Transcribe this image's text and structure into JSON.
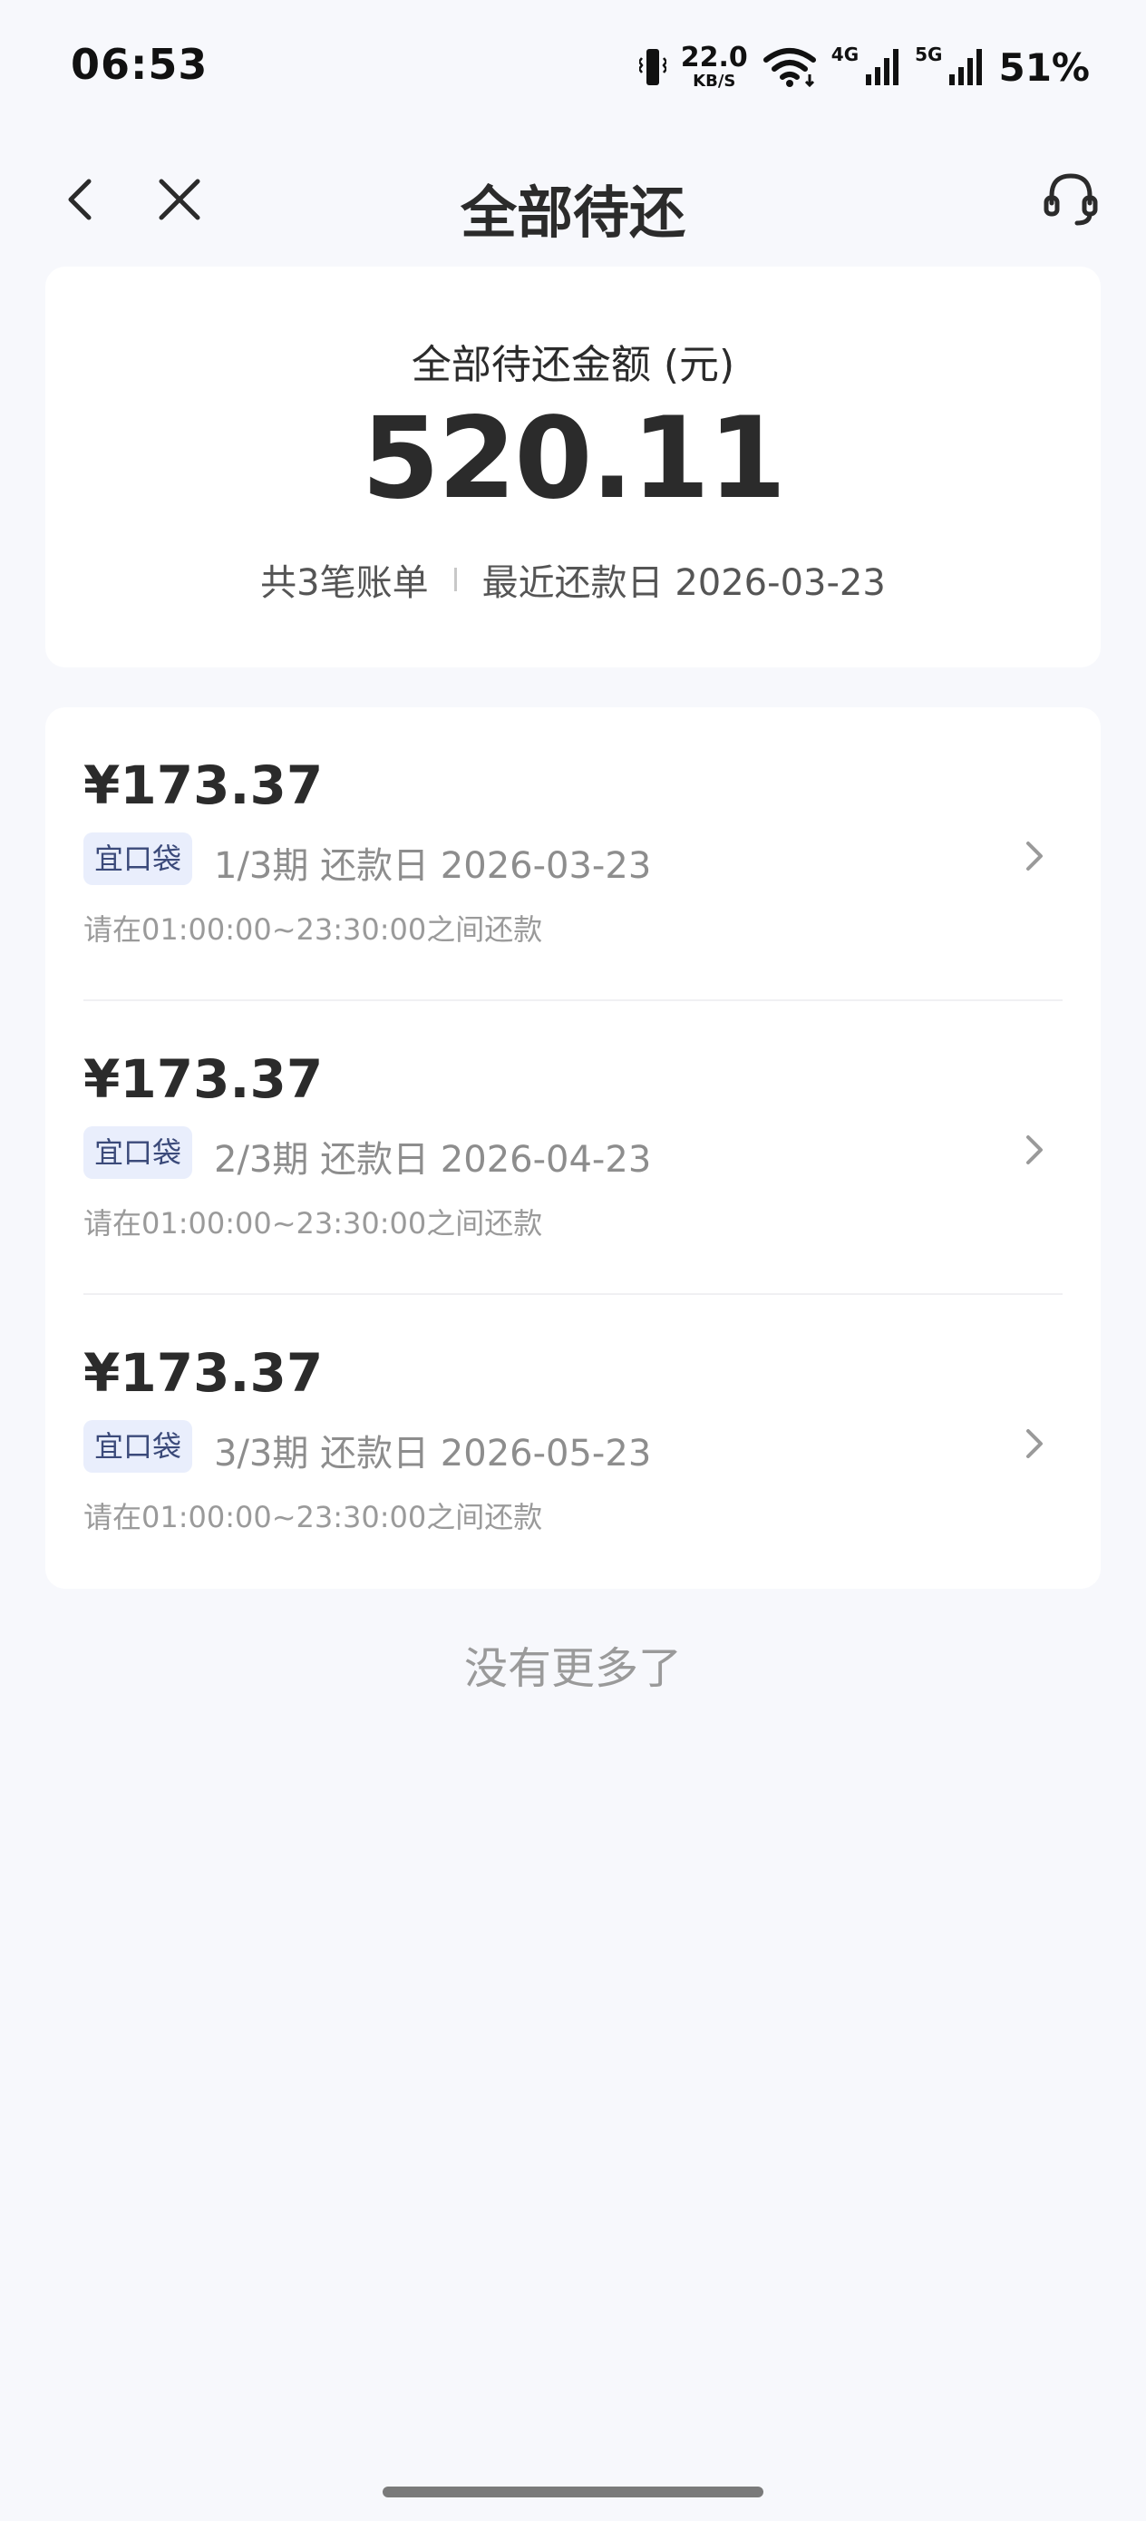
{
  "status_bar": {
    "time": "06:53",
    "net_speed_value": "22.0",
    "net_speed_unit": "KB/S",
    "signal1_label": "4G",
    "signal2_label": "5G",
    "battery": "51%",
    "icons": [
      "vibrate-icon",
      "wifi-icon",
      "signal-icon",
      "signal-icon"
    ]
  },
  "nav": {
    "title": "全部待还",
    "icons": [
      "back-icon",
      "close-icon",
      "customer-service-icon"
    ]
  },
  "summary": {
    "label": "全部待还金额 (元)",
    "amount": "520.11",
    "bill_count": "共3笔账单",
    "next_due": "最近还款日 2026-03-23"
  },
  "bills": [
    {
      "amount": "¥173.37",
      "tag": "宜口袋",
      "period": "1/3期 还款日 2026-03-23",
      "hint": "请在01:00:00~23:30:00之间还款"
    },
    {
      "amount": "¥173.37",
      "tag": "宜口袋",
      "period": "2/3期 还款日 2026-04-23",
      "hint": "请在01:00:00~23:30:00之间还款"
    },
    {
      "amount": "¥173.37",
      "tag": "宜口袋",
      "period": "3/3期 还款日 2026-05-23",
      "hint": "请在01:00:00~23:30:00之间还款"
    }
  ],
  "footer": {
    "no_more": "没有更多了"
  },
  "colors": {
    "background": "#f7f8fc",
    "card": "#ffffff",
    "tag_bg": "#e9eefc",
    "tag_text": "#3b4a7a"
  }
}
